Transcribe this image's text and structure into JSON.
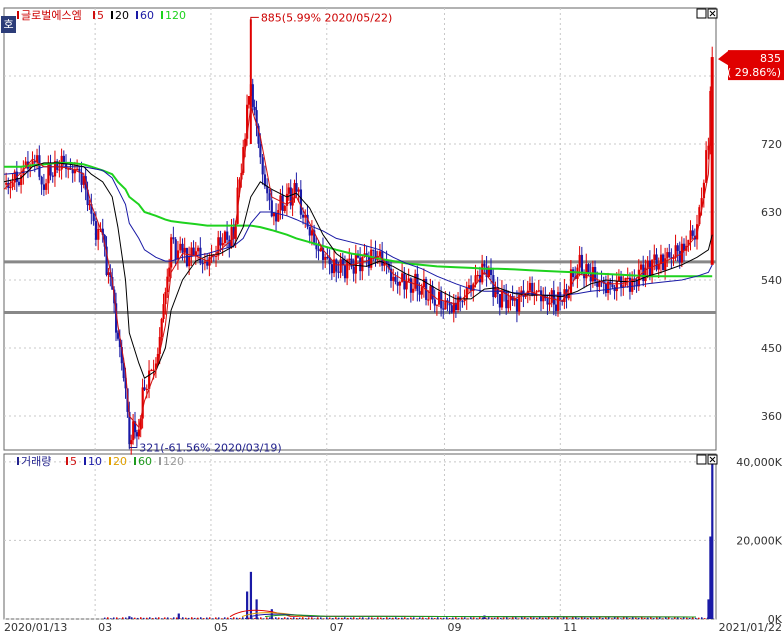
{
  "chart_data": [
    {
      "type": "candlestick",
      "panel": "price",
      "legend": {
        "title": "글로벌에스엠",
        "badge": "호",
        "items": [
          {
            "label": "5",
            "color": "#d01010"
          },
          {
            "label": "20",
            "color": "#000000"
          },
          {
            "label": "60",
            "color": "#1a1aa6"
          },
          {
            "label": "120",
            "color": "#1ed21e"
          }
        ]
      },
      "y_ticks": [
        360,
        450,
        540,
        630,
        720
      ],
      "ylim": [
        315,
        900
      ],
      "current": {
        "price_label": "835",
        "change_label": "( 29.86%)",
        "value": 835,
        "color": "#e00000"
      },
      "annotations": {
        "high": {
          "text": "885(5.99% 2020/05/22)",
          "date": "2020/05/22",
          "value": 885
        },
        "low": {
          "text": "321(-61.56% 2020/03/19)",
          "date": "2020/03/19",
          "value": 321
        }
      },
      "support_lines": [
        564,
        497
      ],
      "series_close": [
        {
          "date": "2020/01/13",
          "value": 660
        },
        {
          "date": "2020/01/22",
          "value": 680
        },
        {
          "date": "2020/01/28",
          "value": 705
        },
        {
          "date": "2020/02/03",
          "value": 670
        },
        {
          "date": "2020/02/10",
          "value": 695
        },
        {
          "date": "2020/02/17",
          "value": 690
        },
        {
          "date": "2020/02/24",
          "value": 675
        },
        {
          "date": "2020/02/28",
          "value": 620
        },
        {
          "date": "2020/03/05",
          "value": 590
        },
        {
          "date": "2020/03/10",
          "value": 520
        },
        {
          "date": "2020/03/13",
          "value": 460
        },
        {
          "date": "2020/03/17",
          "value": 400
        },
        {
          "date": "2020/03/19",
          "value": 330
        },
        {
          "date": "2020/03/24",
          "value": 350
        },
        {
          "date": "2020/03/27",
          "value": 400
        },
        {
          "date": "2020/04/02",
          "value": 430
        },
        {
          "date": "2020/04/07",
          "value": 520
        },
        {
          "date": "2020/04/10",
          "value": 590
        },
        {
          "date": "2020/04/16",
          "value": 570
        },
        {
          "date": "2020/04/23",
          "value": 575
        },
        {
          "date": "2020/04/29",
          "value": 560
        },
        {
          "date": "2020/05/06",
          "value": 590
        },
        {
          "date": "2020/05/13",
          "value": 600
        },
        {
          "date": "2020/05/18",
          "value": 720
        },
        {
          "date": "2020/05/22",
          "value": 800
        },
        {
          "date": "2020/05/27",
          "value": 700
        },
        {
          "date": "2020/06/02",
          "value": 620
        },
        {
          "date": "2020/06/10",
          "value": 650
        },
        {
          "date": "2020/06/15",
          "value": 655
        },
        {
          "date": "2020/06/22",
          "value": 600
        },
        {
          "date": "2020/06/29",
          "value": 570
        },
        {
          "date": "2020/07/06",
          "value": 555
        },
        {
          "date": "2020/07/14",
          "value": 560
        },
        {
          "date": "2020/07/22",
          "value": 570
        },
        {
          "date": "2020/07/29",
          "value": 575
        },
        {
          "date": "2020/08/05",
          "value": 540
        },
        {
          "date": "2020/08/12",
          "value": 535
        },
        {
          "date": "2020/08/20",
          "value": 530
        },
        {
          "date": "2020/08/28",
          "value": 510
        },
        {
          "date": "2020/09/07",
          "value": 505
        },
        {
          "date": "2020/09/15",
          "value": 530
        },
        {
          "date": "2020/09/22",
          "value": 560
        },
        {
          "date": "2020/09/29",
          "value": 520
        },
        {
          "date": "2020/10/08",
          "value": 510
        },
        {
          "date": "2020/10/16",
          "value": 530
        },
        {
          "date": "2020/10/23",
          "value": 515
        },
        {
          "date": "2020/11/02",
          "value": 510
        },
        {
          "date": "2020/11/10",
          "value": 560
        },
        {
          "date": "2020/11/17",
          "value": 545
        },
        {
          "date": "2020/11/25",
          "value": 530
        },
        {
          "date": "2020/12/03",
          "value": 535
        },
        {
          "date": "2020/12/10",
          "value": 540
        },
        {
          "date": "2020/12/17",
          "value": 560
        },
        {
          "date": "2020/12/24",
          "value": 565
        },
        {
          "date": "2021/01/04",
          "value": 580
        },
        {
          "date": "2021/01/12",
          "value": 610
        },
        {
          "date": "2021/01/18",
          "value": 720
        },
        {
          "date": "2021/01/20",
          "value": 835
        }
      ],
      "ma5": [
        660,
        682,
        700,
        690,
        690,
        688,
        680,
        640,
        600,
        540,
        480,
        420,
        360,
        345,
        380,
        420,
        480,
        550,
        575,
        572,
        565,
        580,
        595,
        690,
        770,
        730,
        650,
        640,
        650,
        615,
        580,
        560,
        560,
        565,
        572,
        548,
        538,
        532,
        515,
        508,
        525,
        550,
        528,
        515,
        525,
        518,
        512,
        548,
        545,
        535,
        535,
        540,
        555,
        562,
        575,
        600,
        680,
        800
      ],
      "ma20": [
        670,
        675,
        690,
        695,
        695,
        693,
        690,
        680,
        670,
        650,
        610,
        540,
        470,
        430,
        410,
        420,
        450,
        500,
        540,
        565,
        572,
        575,
        585,
        610,
        650,
        670,
        660,
        650,
        655,
        635,
        600,
        575,
        560,
        558,
        565,
        558,
        548,
        540,
        528,
        515,
        515,
        528,
        530,
        522,
        520,
        520,
        518,
        525,
        535,
        540,
        538,
        538,
        545,
        550,
        560,
        570,
        580,
        600
      ],
      "ma60": [
        680,
        682,
        685,
        690,
        690,
        690,
        690,
        688,
        685,
        675,
        660,
        640,
        615,
        595,
        580,
        570,
        565,
        565,
        570,
        572,
        575,
        580,
        585,
        595,
        615,
        630,
        630,
        625,
        620,
        612,
        605,
        595,
        590,
        585,
        580,
        570,
        562,
        555,
        545,
        535,
        528,
        525,
        525,
        523,
        522,
        520,
        520,
        522,
        525,
        527,
        530,
        532,
        535,
        537,
        540,
        545,
        550,
        560
      ],
      "ma120": [
        690,
        690,
        692,
        693,
        695,
        695,
        693,
        690,
        685,
        680,
        670,
        660,
        650,
        640,
        630,
        625,
        620,
        618,
        616,
        614,
        612,
        612,
        612,
        612,
        612,
        610,
        606,
        600,
        595,
        590,
        585,
        580,
        575,
        572,
        568,
        565,
        562,
        560,
        558,
        557,
        556,
        555,
        555,
        554,
        553,
        552,
        551,
        550,
        549,
        548,
        547,
        546,
        545,
        545,
        545,
        545,
        545,
        545
      ]
    },
    {
      "type": "bar",
      "panel": "volume",
      "legend": {
        "title": "거래량",
        "items": [
          {
            "label": "5",
            "color": "#d01010"
          },
          {
            "label": "10",
            "color": "#1a1aa6"
          },
          {
            "label": "20",
            "color": "#e0a000"
          },
          {
            "label": "60",
            "color": "#1e9a1e"
          },
          {
            "label": "120",
            "color": "#999999"
          }
        ]
      },
      "y_ticks": [
        {
          "label": "0K",
          "value": 0
        },
        {
          "label": "20,000K",
          "value": 20000
        },
        {
          "label": "40,000K",
          "value": 40000
        }
      ],
      "ylim": [
        0,
        42000
      ],
      "spikes": [
        {
          "date": "2020/03/19",
          "value": 700
        },
        {
          "date": "2020/04/14",
          "value": 1400
        },
        {
          "date": "2020/05/20",
          "value": 7000
        },
        {
          "date": "2020/05/22",
          "value": 12000
        },
        {
          "date": "2020/05/25",
          "value": 5000
        },
        {
          "date": "2020/06/02",
          "value": 2500
        },
        {
          "date": "2020/09/22",
          "value": 900
        },
        {
          "date": "2021/01/18",
          "value": 5000
        },
        {
          "date": "2021/01/19",
          "value": 21000
        },
        {
          "date": "2021/01/20",
          "value": 40000
        }
      ]
    }
  ],
  "x_axis": {
    "start_label": "2020/01/13",
    "end_label": "2021/01/22",
    "month_ticks": [
      {
        "label": "03",
        "date": "2020/03/01"
      },
      {
        "label": "05",
        "date": "2020/05/01"
      },
      {
        "label": "07",
        "date": "2020/07/01"
      },
      {
        "label": "09",
        "date": "2020/09/01"
      },
      {
        "label": "11",
        "date": "2020/11/01"
      }
    ]
  },
  "colors": {
    "up": "#e00000",
    "down": "#1a1aa6",
    "grid": "#c8c8c8",
    "support": "#888888"
  },
  "icons": [
    "minimize-icon",
    "close-icon"
  ]
}
